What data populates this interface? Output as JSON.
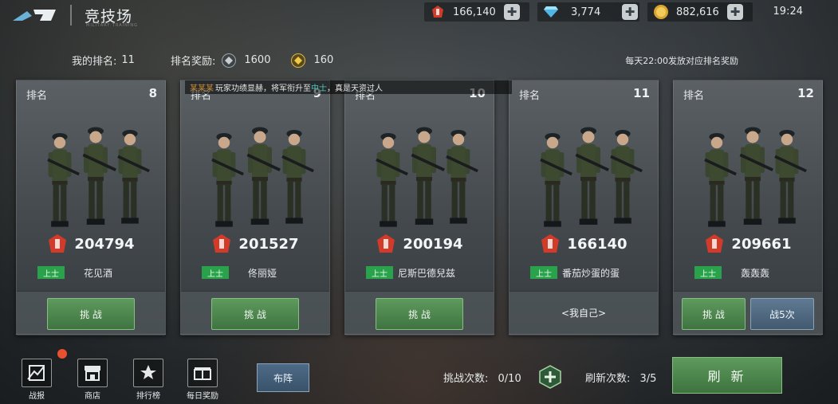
{
  "header": {
    "title": "竞技场",
    "subtitle": "MILITARY TRAINING",
    "time": "19:24",
    "resources": [
      {
        "icon": "red-rank-emblem-icon",
        "value": "166,140"
      },
      {
        "icon": "diamond-icon",
        "value": "3,774"
      },
      {
        "icon": "gold-coin-icon",
        "value": "882,616"
      }
    ]
  },
  "info": {
    "my_rank_label": "我的排名:",
    "my_rank_value": "11",
    "reward_label": "排名奖励:",
    "reward_medal_1": "1600",
    "reward_medal_2": "160",
    "notice": "每天22:00发放对应排名奖励"
  },
  "ticker": {
    "name": "某某某",
    "text_1": "玩家功绩显赫，将军衔升至",
    "rank": "中士",
    "text_2": "，真是天资过人"
  },
  "cards": [
    {
      "rank_label": "排名",
      "rank": "8",
      "power": "204794",
      "badge": "上士",
      "name": "花见酒",
      "action": "挑 战"
    },
    {
      "rank_label": "排名",
      "rank": "9",
      "power": "201527",
      "badge": "上士",
      "name": "佟丽娅",
      "action": "挑 战"
    },
    {
      "rank_label": "排名",
      "rank": "10",
      "power": "200194",
      "badge": "上士",
      "name": "尼斯巴德兒兹",
      "action": "挑 战"
    },
    {
      "rank_label": "排名",
      "rank": "11",
      "power": "166140",
      "badge": "上士",
      "name": "番茄炒蛋的蛋",
      "action": "<我自己>"
    },
    {
      "rank_label": "排名",
      "rank": "12",
      "power": "209661",
      "badge": "上士",
      "name": "轰轰轰",
      "action": "挑 战",
      "sweep": "战5次"
    }
  ],
  "bottom": {
    "nav": [
      {
        "label": "战报",
        "icon": "battle-report-icon"
      },
      {
        "label": "商店",
        "icon": "shop-icon"
      },
      {
        "label": "排行榜",
        "icon": "leaderboard-icon"
      },
      {
        "label": "每日奖励",
        "icon": "daily-reward-icon"
      }
    ],
    "formation": "布阵",
    "challenge_label": "挑战次数:",
    "challenge_value": "0/10",
    "refresh_label": "刷新次数:",
    "refresh_value": "3/5",
    "refresh_button": "刷 新"
  },
  "colors": {
    "accent_green": "#3f7441",
    "rank_badge": "#2aa24c",
    "ticker_rank": "#4fc6c2",
    "notification_dot": "#e9502f"
  }
}
